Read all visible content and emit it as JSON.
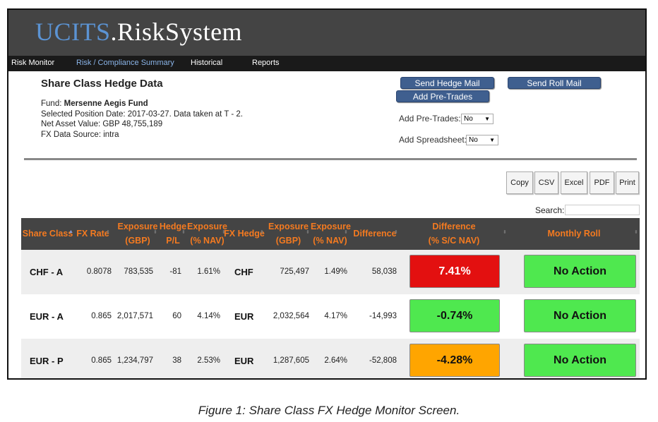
{
  "app": {
    "logo_prefix": "UCITS",
    "logo_suffix": ".RiskSystem"
  },
  "nav": [
    {
      "label": "Risk Monitor"
    },
    {
      "label": "Risk / Compliance Summary",
      "active": true
    },
    {
      "label": "Historical"
    },
    {
      "label": "Reports"
    }
  ],
  "page": {
    "title": "Share Class Hedge Data",
    "fund_label": "Fund: ",
    "fund_name": "Mersenne Aegis Fund",
    "position_date": "Selected Position Date: 2017-03-27. Data taken at T - 2.",
    "nav_value": "Net Asset Value: GBP 48,755,189",
    "fx_source": "FX Data Source: intra"
  },
  "actions": {
    "send_hedge_mail": "Send Hedge Mail",
    "send_roll_mail": "Send Roll Mail",
    "add_pre_trades": "Add Pre-Trades",
    "pre_trades_label": "Add Pre-Trades:",
    "pre_trades_value": "No",
    "spreadsheet_label": "Add Spreadsheet:",
    "spreadsheet_value": "No"
  },
  "export": [
    "Copy",
    "CSV",
    "Excel",
    "PDF",
    "Print"
  ],
  "search": {
    "label": "Search:",
    "value": ""
  },
  "table": {
    "headers": [
      [
        "Share Class"
      ],
      [
        "FX Rate"
      ],
      [
        "Exposure",
        "(GBP)"
      ],
      [
        "Hedge",
        "P/L"
      ],
      [
        "Exposure",
        "(% NAV)"
      ],
      [
        "FX Hedge"
      ],
      [
        "Exposure",
        "(GBP)"
      ],
      [
        "Exposure",
        "(% NAV)"
      ],
      [
        "Difference"
      ],
      [
        "Difference",
        "(% S/C NAV)"
      ],
      [
        "Monthly Roll"
      ]
    ],
    "rows": [
      {
        "share_class": "CHF - A",
        "fx_rate": "0.8078",
        "exposure_gbp": "783,535",
        "hedge_pl": "-81",
        "exposure_nav": "1.61%",
        "fx_hedge": "CHF",
        "hedge_exposure_gbp": "725,497",
        "hedge_exposure_nav": "1.49%",
        "difference": "58,038",
        "difference_pct": "7.41%",
        "difference_status": "red",
        "monthly_roll": "No Action"
      },
      {
        "share_class": "EUR - A",
        "fx_rate": "0.865",
        "exposure_gbp": "2,017,571",
        "hedge_pl": "60",
        "exposure_nav": "4.14%",
        "fx_hedge": "EUR",
        "hedge_exposure_gbp": "2,032,564",
        "hedge_exposure_nav": "4.17%",
        "difference": "-14,993",
        "difference_pct": "-0.74%",
        "difference_status": "green",
        "monthly_roll": "No Action"
      },
      {
        "share_class": "EUR - P",
        "fx_rate": "0.865",
        "exposure_gbp": "1,234,797",
        "hedge_pl": "38",
        "exposure_nav": "2.53%",
        "fx_hedge": "EUR",
        "hedge_exposure_gbp": "1,287,605",
        "hedge_exposure_nav": "2.64%",
        "difference": "-52,808",
        "difference_pct": "-4.28%",
        "difference_status": "amber",
        "monthly_roll": "No Action"
      }
    ]
  },
  "colors": {
    "header_text": "#f47a20",
    "red": "#e31010",
    "green": "#4fe84f",
    "amber": "#ffa500",
    "nav_active": "#8ab4e8",
    "logo_accent": "#5b93d3"
  },
  "caption": "Figure 1: Share Class FX Hedge Monitor Screen."
}
